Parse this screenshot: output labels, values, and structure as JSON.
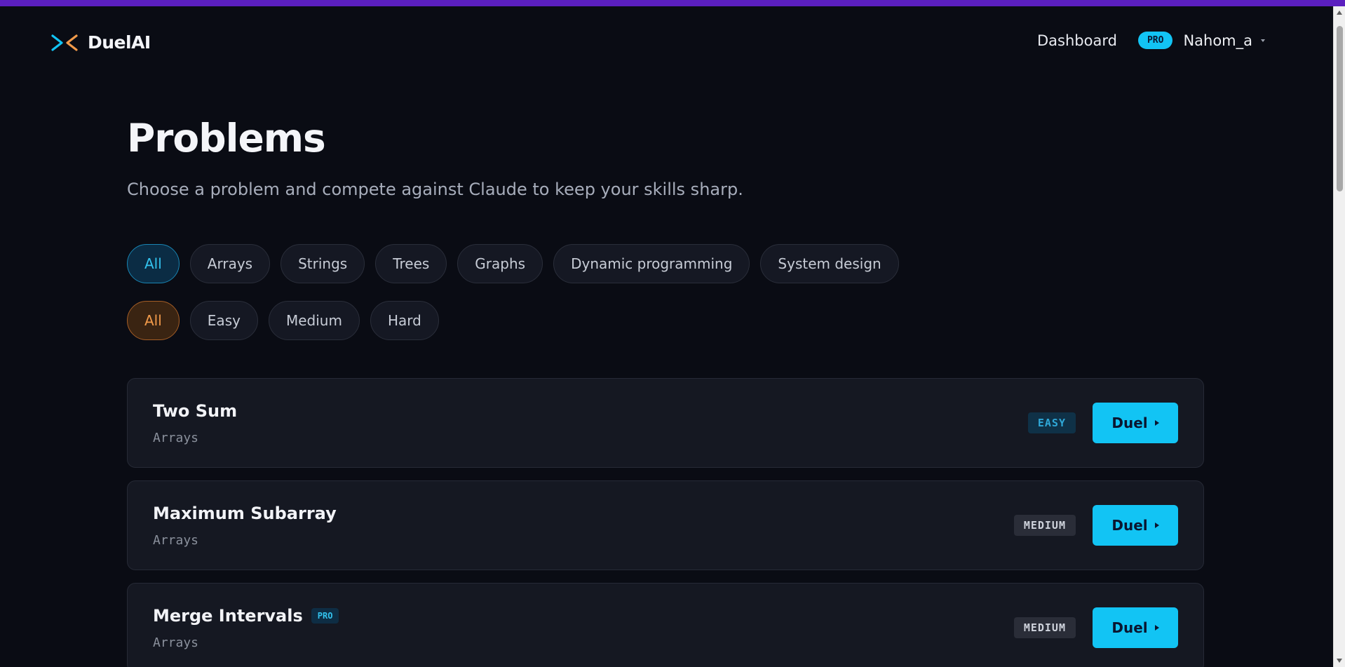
{
  "colors": {
    "accent_bar": "#5b1fbf",
    "background": "#0a0c14",
    "primary_button": "#12c4f4",
    "active_topic": "#33c3ee",
    "active_level": "#f19a4a"
  },
  "nav": {
    "brand": "DuelAI",
    "brand_icon": "duelai-logo-icon",
    "dashboard_label": "Dashboard",
    "plan_badge": "PRO",
    "username": "Nahom_a"
  },
  "page": {
    "title": "Problems",
    "subtitle": "Choose a problem and compete against Claude to keep your skills sharp."
  },
  "topic_filters": [
    "All",
    "Arrays",
    "Strings",
    "Trees",
    "Graphs",
    "Dynamic programming",
    "System design"
  ],
  "topic_selected": "All",
  "level_filters": [
    "All",
    "Easy",
    "Medium",
    "Hard"
  ],
  "level_selected": "All",
  "problems": [
    {
      "title": "Two Sum",
      "topic": "Arrays",
      "difficulty": "EASY",
      "pro": false,
      "action": "Duel"
    },
    {
      "title": "Maximum Subarray",
      "topic": "Arrays",
      "difficulty": "MEDIUM",
      "pro": false,
      "action": "Duel"
    },
    {
      "title": "Merge Intervals",
      "topic": "Arrays",
      "difficulty": "MEDIUM",
      "pro": true,
      "pro_label": "PRO",
      "action": "Duel"
    }
  ]
}
